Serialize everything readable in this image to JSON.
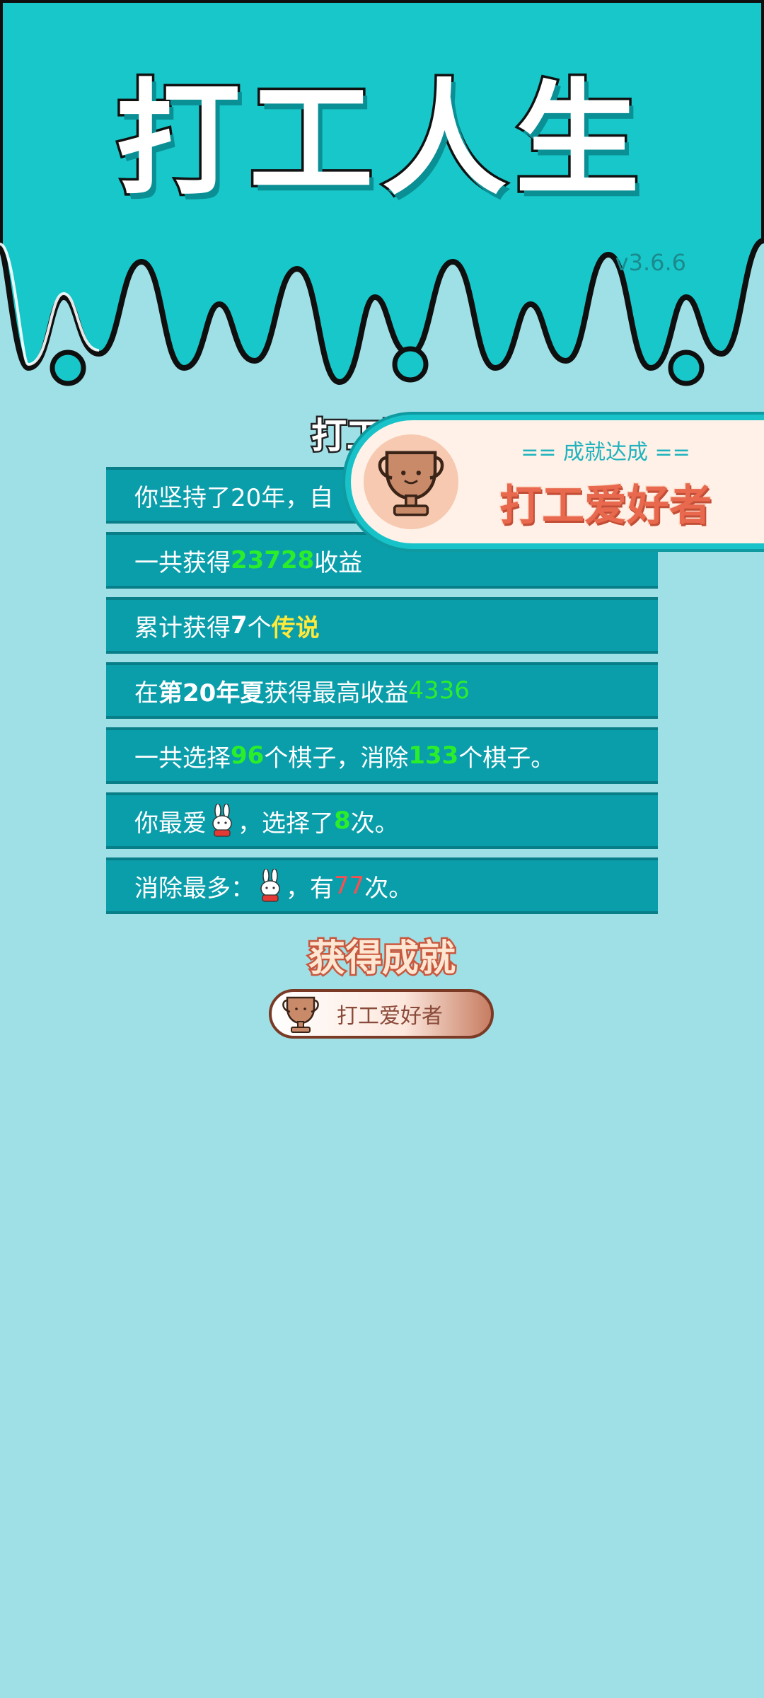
{
  "app": {
    "title": "打工人生",
    "version": "v3.6.6"
  },
  "summary": {
    "title": "打工回顾",
    "stats": [
      {
        "text": "你坚持了20年，自"
      },
      {
        "prefix": "一共获得",
        "value": "23728",
        "suffix": "收益"
      },
      {
        "prefix": "累计获得",
        "value": "7",
        "middle": "个",
        "highlight": "传说"
      },
      {
        "prefix": "在 ",
        "bold": "第20年夏",
        "middle": " 获得最高收益",
        "value": "4336"
      },
      {
        "prefix": "一共选择",
        "value1": "96",
        "middle": "个棋子，消除",
        "value2": "133",
        "suffix": "个棋子。"
      },
      {
        "prefix": "你最爱",
        "icon": "bunny-icon",
        "middle": "，选择了",
        "value": "8",
        "suffix": "次。"
      },
      {
        "prefix": "消除最多：",
        "icon": "bunny-icon",
        "middle": "，有",
        "value": "77",
        "suffix": "次。"
      }
    ]
  },
  "achievements": {
    "heading": "获得成就",
    "pill_label": "打工爱好者",
    "icon": "trophy-icon"
  },
  "toast": {
    "subtitle": "== 成就达成 ==",
    "name": "打工爱好者",
    "icon": "trophy-icon"
  },
  "colors": {
    "header": "#17c7c9",
    "background": "#9fdfe6",
    "row": "#0a9eab",
    "green_value": "#2bee2b",
    "yellow_value": "#ffe93a",
    "red_value": "#ff4d4d",
    "toast_border": "#17c2c8",
    "achievement_text": "#e8694d"
  }
}
